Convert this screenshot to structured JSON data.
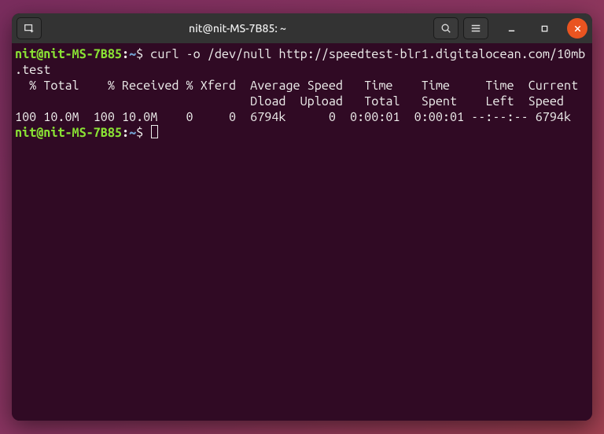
{
  "titlebar": {
    "title": "nit@nit-MS-7B85: ~"
  },
  "prompt": {
    "user": "nit@nit-MS-7B85",
    "colon": ":",
    "path": "~",
    "dollar": "$ "
  },
  "command1": "curl -o /dev/null http://speedtest-blr1.digitalocean.com/10mb",
  "command1_wrap": ".test",
  "out_header1": "  % Total    % Received % Xferd  Average Speed   Time    Time     Time  Current",
  "out_header2": "                                 Dload  Upload   Total   Spent    Left  Speed",
  "out_row": "100 10.0M  100 10.0M    0     0  6794k      0  0:00:01  0:00:01 --:--:-- 6794k"
}
